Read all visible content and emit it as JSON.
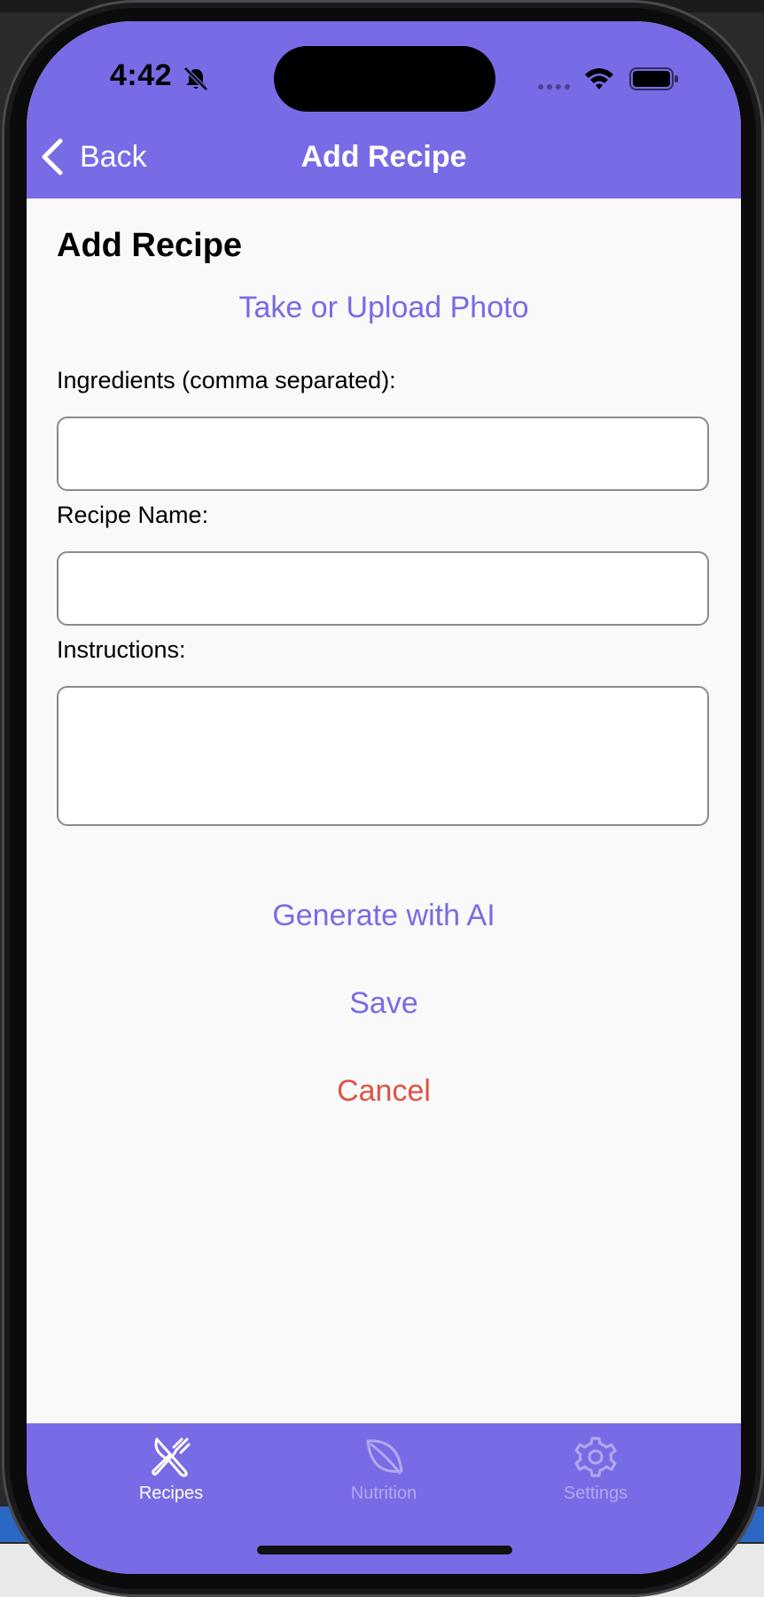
{
  "status_bar": {
    "time": "4:42"
  },
  "nav": {
    "back_label": "Back",
    "title": "Add Recipe"
  },
  "form": {
    "page_title": "Add Recipe",
    "photo_button": "Take or Upload Photo",
    "ingredients_label": "Ingredients (comma separated):",
    "ingredients_value": "",
    "recipe_name_label": "Recipe Name:",
    "recipe_name_value": "",
    "instructions_label": "Instructions:",
    "instructions_value": "",
    "generate_button": "Generate with AI",
    "save_button": "Save",
    "cancel_button": "Cancel"
  },
  "tabs": [
    {
      "label": "Recipes",
      "icon": "fork-knife-icon",
      "active": true
    },
    {
      "label": "Nutrition",
      "icon": "leaf-icon",
      "active": false
    },
    {
      "label": "Settings",
      "icon": "gear-icon",
      "active": false
    }
  ],
  "colors": {
    "accent": "#786be6",
    "cancel": "#e05245",
    "tab_inactive": "#b3aaf0",
    "background": "#f9f9f9"
  }
}
